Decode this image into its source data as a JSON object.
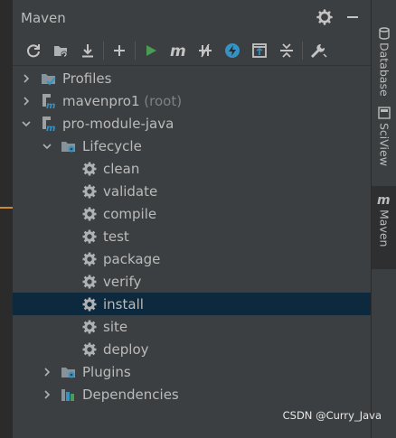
{
  "panel": {
    "title": "Maven"
  },
  "toolbar": {
    "buttons": [
      "reload-icon",
      "generate-sources-icon",
      "download-icon",
      "add-icon",
      "run-icon",
      "maven-goal-icon",
      "toggle-offline-icon",
      "skip-tests-icon",
      "show-dependencies-icon",
      "collapse-all-icon",
      "settings-wrench-icon"
    ]
  },
  "tree": {
    "profiles": "Profiles",
    "project1": {
      "name": "mavenpro1",
      "suffix": "(root)"
    },
    "project2": {
      "name": "pro-module-java"
    },
    "lifecycle": {
      "label": "Lifecycle",
      "goals": [
        "clean",
        "validate",
        "compile",
        "test",
        "package",
        "verify",
        "install",
        "site",
        "deploy"
      ]
    },
    "plugins": "Plugins",
    "dependencies": "Dependencies"
  },
  "right_tabs": {
    "database": "Database",
    "sciview": "SciView",
    "maven": "Maven"
  },
  "watermark": "CSDN @Curry_Java",
  "colors": {
    "selection": "#0d293e",
    "run_green": "#499c54",
    "update_blue": "#3592c4"
  }
}
